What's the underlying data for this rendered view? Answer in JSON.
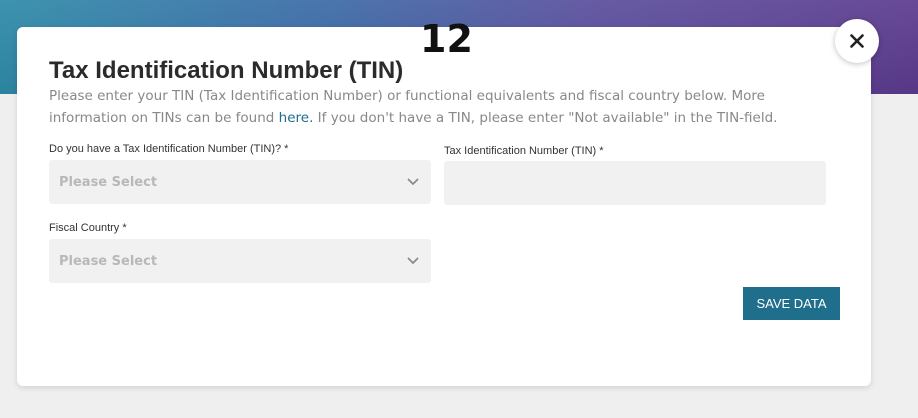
{
  "step_number": "12",
  "modal": {
    "title": "Tax Identification Number (TIN)",
    "description": {
      "before_link": "Please enter your TIN (Tax Identification Number) or functional equivalents and fiscal country below. More information on TINs can be found ",
      "link_text": "here.",
      "after_link": " If you don't have a TIN, please enter \"Not available\" in the TIN-field."
    },
    "fields": {
      "has_tin": {
        "label": "Do you have a Tax Identification Number (TIN)? *",
        "placeholder": "Please Select"
      },
      "tin": {
        "label": "Tax Identification Number (TIN) *",
        "value": ""
      },
      "fiscal_country": {
        "label": "Fiscal Country *",
        "placeholder": "Please Select"
      }
    },
    "save_button_label": "SAVE DATA",
    "close_icon": "close-icon"
  },
  "colors": {
    "accent": "#1f6e8c",
    "banner_start": "#2d8aa8",
    "banner_end": "#5b3a8e",
    "field_bg": "#f1f1f1",
    "placeholder": "#b8b8b8"
  }
}
